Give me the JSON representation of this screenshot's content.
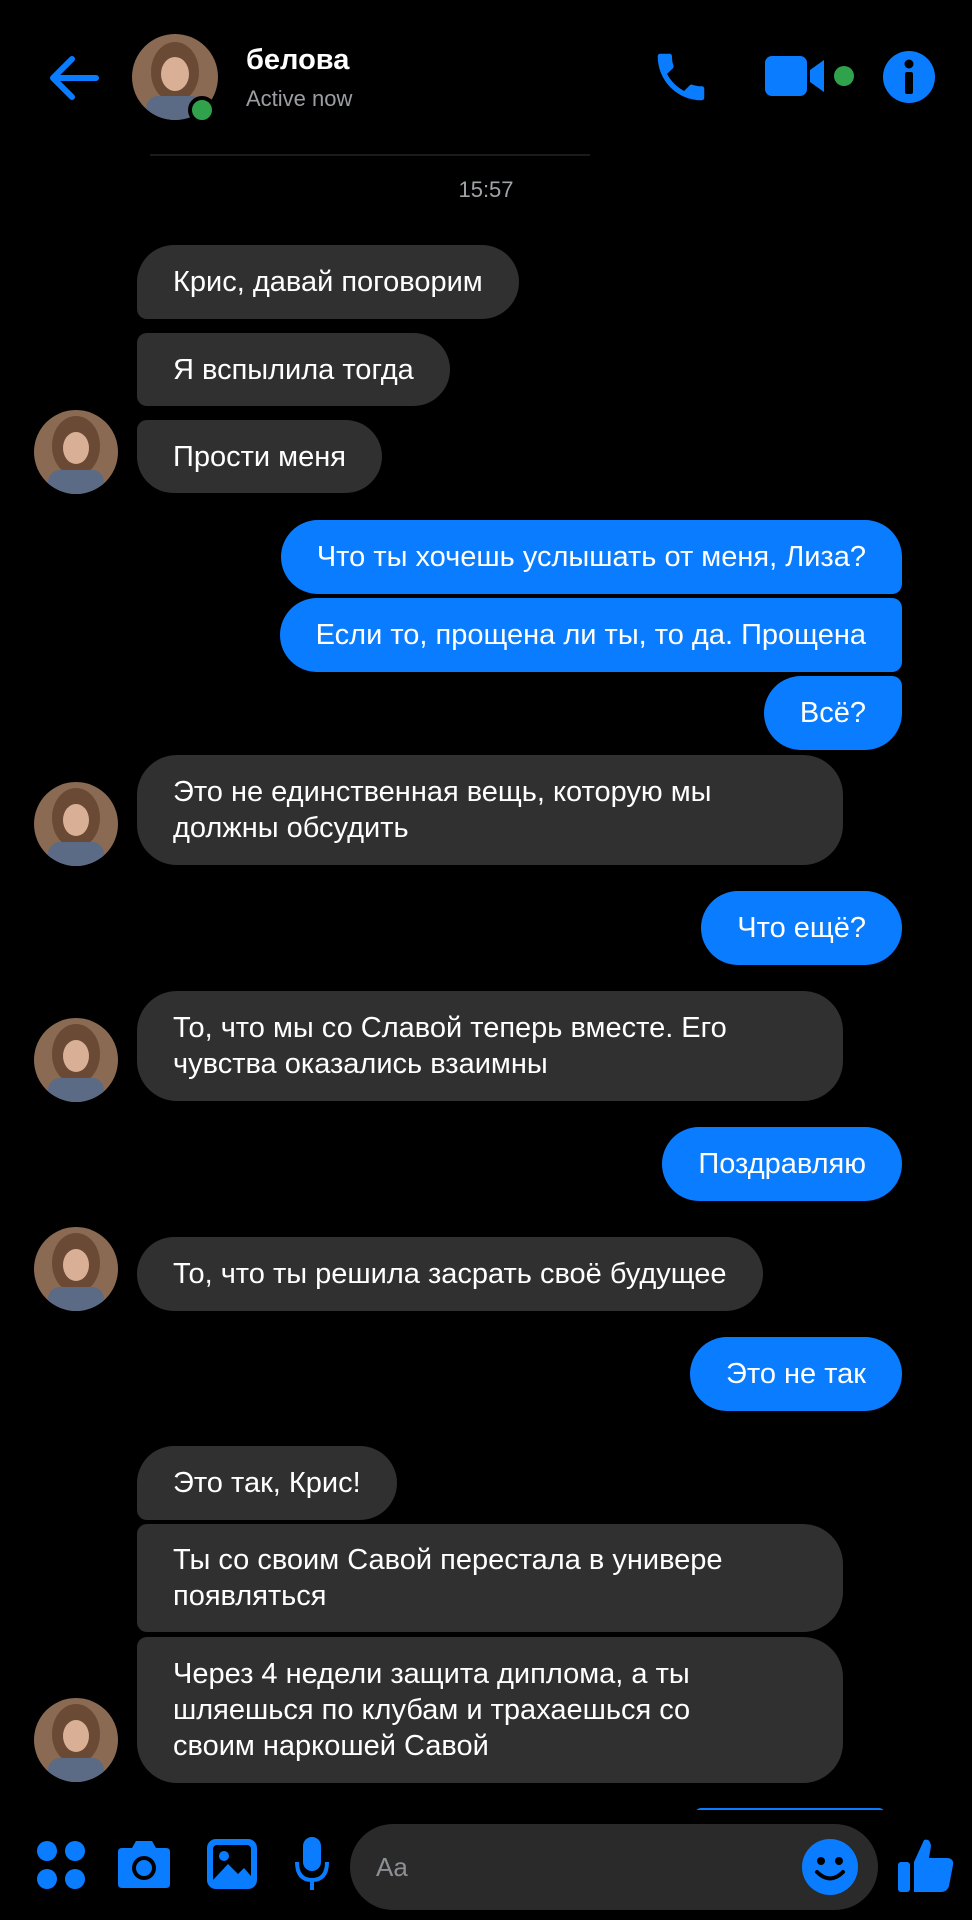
{
  "header": {
    "contact_name": "белова",
    "status": "Active now",
    "icons": {
      "back": "arrow-left-icon",
      "call": "phone-icon",
      "video": "video-camera-icon",
      "info": "info-icon"
    }
  },
  "timestamp": "15:57",
  "messages": [
    {
      "side": "in",
      "text": "Крис, давай поговорим"
    },
    {
      "side": "in",
      "text": "Я вспылила тогда"
    },
    {
      "side": "in",
      "text": "Прости меня"
    },
    {
      "side": "out",
      "text": "Что ты хочешь услышать от меня, Лиза?"
    },
    {
      "side": "out",
      "text": "Если то, прощена ли ты, то да.  Прощена"
    },
    {
      "side": "out",
      "text": "Всё?"
    },
    {
      "side": "in",
      "lines": [
        "Это не единственная вещь, которую мы",
        "должны обсудить"
      ]
    },
    {
      "side": "out",
      "text": "Что ещё?"
    },
    {
      "side": "in",
      "lines": [
        "То, что мы со Славой теперь вместе.  Его",
        "чувства оказались взаимны"
      ]
    },
    {
      "side": "out",
      "text": "Поздравляю"
    },
    {
      "side": "in",
      "text": "То, что ты решила засрать своё будущее"
    },
    {
      "side": "out",
      "text": "Это не так"
    },
    {
      "side": "in",
      "text": "Это так, Крис!"
    },
    {
      "side": "in",
      "lines": [
        "Ты со своим Савой перестала в универе",
        "появляться"
      ]
    },
    {
      "side": "in",
      "lines": [
        "Через 4 недели защита диплома, а ты",
        "шляешься по клубам и трахаешься со",
        "своим наркошей Савой"
      ]
    }
  ],
  "composer": {
    "placeholder": "Aa",
    "icons": [
      "apps-icon",
      "camera-icon",
      "gallery-icon",
      "microphone-icon",
      "emoji-icon",
      "thumbs-up-icon"
    ]
  },
  "colors": {
    "accent": "#0a7cff",
    "incoming_bubble": "#303030",
    "online": "#31a24c",
    "background": "#000000"
  }
}
